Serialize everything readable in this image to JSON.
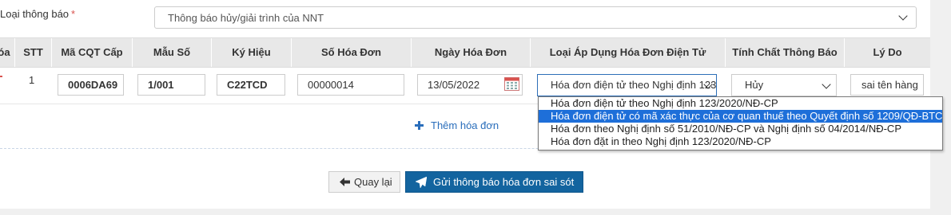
{
  "notice_type": {
    "label": "Loại thông báo",
    "required_mark": "*",
    "selected": "Thông báo hủy/giải trình của NNT"
  },
  "table": {
    "headers": [
      "óa",
      "STT",
      "Mã CQT Cấp",
      "Mẫu Số",
      "Ký Hiệu",
      "Số Hóa Đơn",
      "Ngày Hóa Đơn",
      "Loại Áp Dụng Hóa Đơn Điện Tử",
      "Tính Chất Thông Báo",
      "Lý Do"
    ],
    "rows": [
      {
        "stt": "1",
        "ma_cqt": "0006DA69",
        "mau_so": "1/001",
        "ky_hieu": "C22TCD",
        "so_hoa_don": "00000014",
        "ngay_hoa_don": "13/05/2022",
        "loai_ap_dung": "Hóa đơn điện tử theo Nghị định 123/2020/NĐ-CP",
        "tinh_chat": "Hủy",
        "ly_do": "sai tên hàng"
      }
    ],
    "add_label": "Thêm hóa đơn"
  },
  "dropdown": {
    "options": [
      "Hóa đơn điện tử theo Nghị định 123/2020/NĐ-CP",
      "Hóa đơn điện tử có mã xác thực của cơ quan thuế theo Quyết định số 1209/QĐ-BTC",
      "Hóa đơn theo Nghị định số 51/2010/NĐ-CP và Nghị định số 04/2014/NĐ-CP",
      "Hóa đơn đặt in theo Nghị định 123/2020/NĐ-CP"
    ],
    "highlighted_index": 1
  },
  "buttons": {
    "back": "Quay lại",
    "send": "Gửi thông báo hóa đơn sai sót"
  },
  "colors": {
    "primary": "#13649f",
    "link": "#2a6ebb",
    "highlight": "#1e6fd9",
    "required": "#d9534f"
  }
}
